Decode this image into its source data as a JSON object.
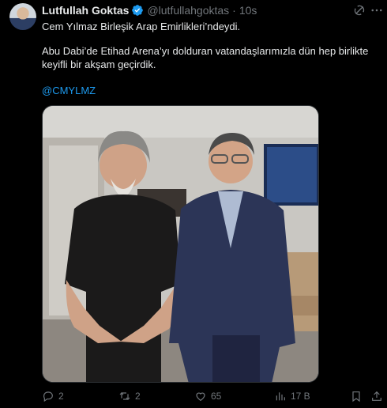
{
  "tweet": {
    "author_name": "Lutfullah Goktas",
    "handle": "@lutfullahgoktas",
    "separator": "·",
    "time": "10s",
    "text_line1": "Cem Yılmaz Birleşik Arap Emirlikleri’ndeydi.",
    "text_line2": "Abu Dabi’de Etihad Arena’yı dolduran vatandaşlarımızla dün hep birlikte keyifli bir akşam geçirdik.",
    "mention": "@CMYLMZ"
  },
  "actions": {
    "replies": "2",
    "retweets": "2",
    "likes": "65",
    "views": "17 B"
  },
  "icons": {
    "verified": "verified-badge-icon",
    "grok": "grok-icon",
    "more": "more-icon",
    "reply": "reply-icon",
    "retweet": "retweet-icon",
    "like": "like-icon",
    "views": "views-icon",
    "bookmark": "bookmark-icon",
    "share": "share-icon"
  },
  "colors": {
    "background": "#000000",
    "text": "#e7e9ea",
    "muted": "#71767b",
    "accent": "#1d9bf0"
  }
}
